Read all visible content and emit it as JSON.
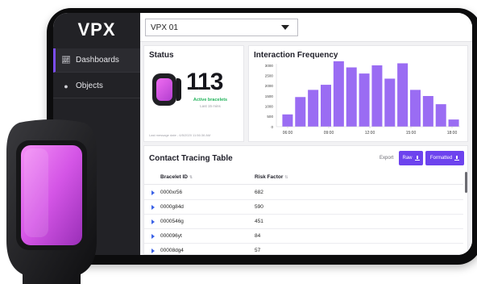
{
  "sidebar": {
    "logo": "VPX",
    "items": [
      {
        "label": "Dashboards",
        "icon": "chart-icon",
        "active": true
      },
      {
        "label": "Objects",
        "icon": "pin-icon",
        "active": false
      }
    ]
  },
  "topbar": {
    "device_select": {
      "value": "VPX 01"
    }
  },
  "status": {
    "title": "Status",
    "count": "113",
    "active_label": "Active bracelets",
    "active_sub": "Last 15 mins",
    "last_message": "Last message date - 6/5/2020 11:56:36 AM"
  },
  "interaction": {
    "title": "Interaction Frequency"
  },
  "chart_data": {
    "type": "bar",
    "title": "Interaction Frequency",
    "x_ticks": [
      "06:00",
      "09:00",
      "12:00",
      "15:00",
      "18:00"
    ],
    "y_ticks": [
      0,
      500,
      1000,
      1500,
      2000,
      2500,
      3000
    ],
    "ylim": [
      0,
      3000
    ],
    "values": [
      600,
      1450,
      1800,
      2050,
      3200,
      2900,
      2600,
      3000,
      2350,
      3100,
      1800,
      1500,
      1100,
      350
    ],
    "bar_color": "#9a6cf3",
    "grid": false
  },
  "table": {
    "title": "Contact Tracing Table",
    "export_label": "Export",
    "raw_button": "Raw",
    "formatted_button": "Formatted",
    "columns": [
      "Bracelet ID",
      "Risk Factor"
    ],
    "rows": [
      {
        "id": "0000xr56",
        "risk": "682"
      },
      {
        "id": "0000g84d",
        "risk": "590"
      },
      {
        "id": "0000546g",
        "risk": "451"
      },
      {
        "id": "000096yt",
        "risk": "84"
      },
      {
        "id": "00008dg4",
        "risk": "57"
      }
    ]
  },
  "colors": {
    "accent": "#6d43ee",
    "active_green": "#22b35b",
    "sidebar_bg": "#222226",
    "bar": "#9a6cf3",
    "bracelet_screen": "#d95bea"
  }
}
